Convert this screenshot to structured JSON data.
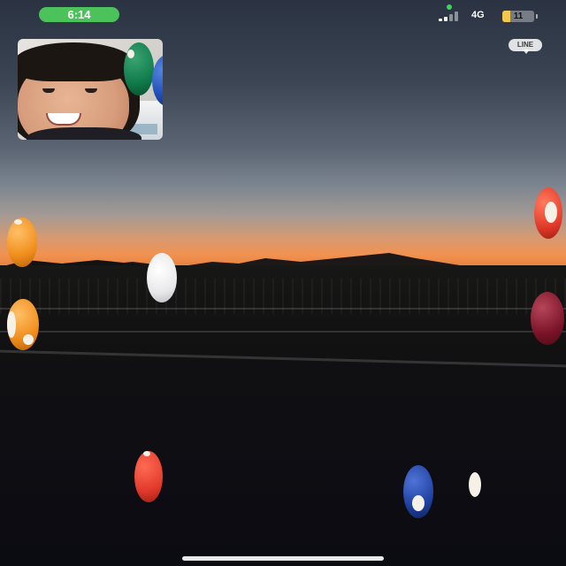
{
  "status_bar": {
    "time": "6:14",
    "network": "4G",
    "battery_level": "11",
    "battery_fraction": 0.11,
    "signal_bars_active": 2,
    "signal_bars_total": 4,
    "call_pill_color": "#4cc35a"
  },
  "app_badge": {
    "label": "LINE"
  },
  "self_view": {
    "icon": "camera-self-preview"
  },
  "effects": {
    "type": "billiard-balls",
    "colors": [
      "#0f7a4a",
      "#1f4fb8",
      "#f08c1a",
      "#f3f3f3",
      "#e23a2a",
      "#7a1428",
      "#1d3f9e"
    ]
  }
}
